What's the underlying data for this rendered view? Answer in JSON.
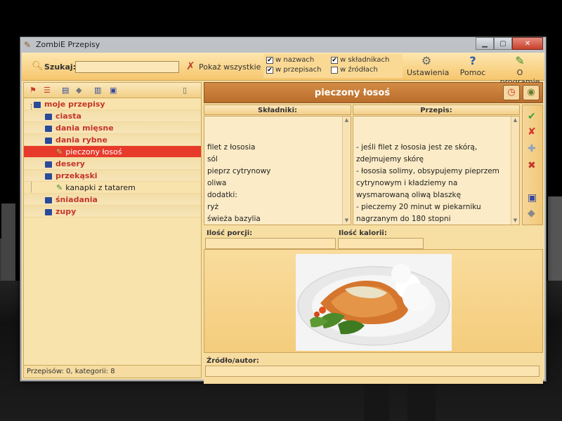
{
  "window": {
    "title": "ZombiE Przepisy"
  },
  "toolbar": {
    "search_label": "Szukaj:",
    "search_value": "",
    "show_all": "Pokaż wszystkie",
    "filters": [
      {
        "label": "w nazwach",
        "checked": true
      },
      {
        "label": "w składnikach",
        "checked": true
      },
      {
        "label": "w przepisach",
        "checked": true
      },
      {
        "label": "w źródłach",
        "checked": false
      }
    ],
    "settings": "Ustawienia",
    "help": "Pomoc",
    "about": "O programie"
  },
  "tree": {
    "root": "moje przepisy",
    "categories": [
      "ciasta",
      "dania mięsne",
      "dania rybne",
      "desery",
      "przekąski",
      "śniadania",
      "zupy"
    ],
    "rybne_item": "pieczony łosoś",
    "przekaski_item": "kanapki z tatarem"
  },
  "status": "Przepisów: 0, kategorii: 8",
  "recipe": {
    "title": "pieczony łosoś",
    "ingredients_header": "Składniki:",
    "recipe_header": "Przepis:",
    "ingredients": "filet z łososia\nsól\npieprz cytrynowy\noliwa\ndodatki:\nryż\nświeża bazylia",
    "instructions": "- jeśli filet z łososia jest ze skórą, zdejmujemy skórę\n- łososia solimy, obsypujemy pieprzem cytrynowym i kładziemy na wysmarowaną oliwą blaszkę\n- pieczemy 20 minut w piekarniku nagrzanym do 180 stopni\n- podajemy z ryżem, ozdabiamy liśćmi bazylii",
    "portions_label": "Ilość porcji:",
    "portions_value": "",
    "calories_label": "Ilość kalorii:",
    "calories_value": "",
    "source_label": "Źródło/autor:",
    "source_value": ""
  }
}
